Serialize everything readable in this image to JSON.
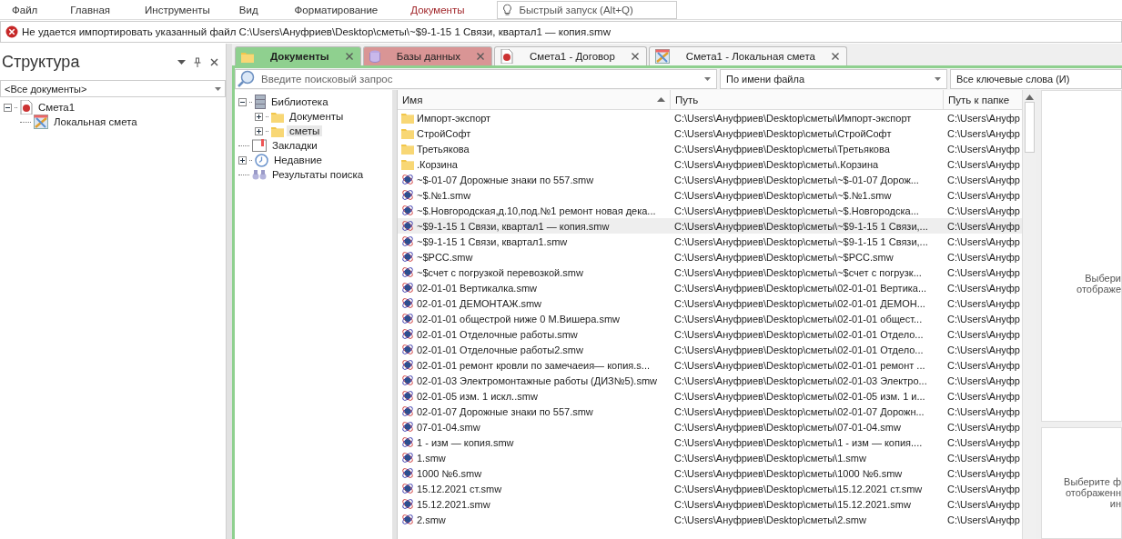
{
  "menu": [
    {
      "label": "Файл",
      "selected": false
    },
    {
      "label": "Главная",
      "selected": false
    },
    {
      "label": "Инструменты",
      "selected": false
    },
    {
      "label": "Вид",
      "selected": false
    },
    {
      "label": "Форматирование",
      "selected": false
    },
    {
      "label": "Документы",
      "selected": true
    }
  ],
  "quick_launch": {
    "placeholder": "Быстрый запуск (Alt+Q)"
  },
  "error_bar": {
    "message": "Не удается импортировать указанный файл C:\\Users\\Ануфриев\\Desktop\\сметы\\~$9-1-15 1 Связи, квартал1 — копия.smw"
  },
  "structure_panel": {
    "title": "Структура",
    "filter": "<Все документы>",
    "tree": [
      {
        "label": "Смета1",
        "kind": "estimate",
        "expanded": true,
        "children": [
          {
            "label": "Локальная смета",
            "kind": "local"
          }
        ]
      }
    ]
  },
  "tabs": [
    {
      "label": "Документы",
      "kind": "folder",
      "selected": true,
      "color": "#8fd08f"
    },
    {
      "label": "Базы данных",
      "kind": "database",
      "selected": false,
      "color": "#d99595"
    },
    {
      "label": "Смета1 - Договор",
      "kind": "estimate",
      "selected": false,
      "color": "#f7f7f7"
    },
    {
      "label": "Смета1 - Локальная смета",
      "kind": "local",
      "selected": false,
      "color": "#f7f7f7"
    }
  ],
  "search": {
    "placeholder": "Введите поисковый запрос",
    "mode": "По имени файла",
    "keywords": "Все ключевые слова (И)"
  },
  "library_tree": [
    {
      "label": "Библиотека",
      "kind": "library",
      "expanded": true,
      "selected": false,
      "children": [
        {
          "label": "Документы",
          "kind": "folder",
          "expanded": false,
          "selected": false
        },
        {
          "label": "сметы",
          "kind": "folder",
          "expanded": false,
          "selected": true
        }
      ]
    },
    {
      "label": "Закладки",
      "kind": "bookmarks",
      "selected": false
    },
    {
      "label": "Недавние",
      "kind": "recent",
      "expanded": false,
      "selected": false
    },
    {
      "label": "Результаты поиска",
      "kind": "search",
      "selected": false
    }
  ],
  "table": {
    "columns": [
      "Имя",
      "Путь",
      "Путь к папке"
    ],
    "rows": [
      {
        "kind": "folder",
        "selected": false,
        "cells": [
          "Импорт-экспорт",
          "C:\\Users\\Ануфриев\\Desktop\\сметы\\Импорт-экспорт",
          "C:\\Users\\Ануфр"
        ]
      },
      {
        "kind": "folder",
        "selected": false,
        "cells": [
          "СтройСофт",
          "C:\\Users\\Ануфриев\\Desktop\\сметы\\СтройСофт",
          "C:\\Users\\Ануфр"
        ]
      },
      {
        "kind": "folder",
        "selected": false,
        "cells": [
          "Третьякова",
          "C:\\Users\\Ануфриев\\Desktop\\сметы\\Третьякова",
          "C:\\Users\\Ануфр"
        ]
      },
      {
        "kind": "folder",
        "selected": false,
        "cells": [
          ".Корзина",
          "C:\\Users\\Ануфриев\\Desktop\\сметы\\.Корзина",
          "C:\\Users\\Ануфр"
        ]
      },
      {
        "kind": "file",
        "selected": false,
        "cells": [
          "~$-01-07 Дорожные знаки по 557.smw",
          "C:\\Users\\Ануфриев\\Desktop\\сметы\\~$-01-07 Дорож...",
          "C:\\Users\\Ануфр"
        ]
      },
      {
        "kind": "file",
        "selected": false,
        "cells": [
          "~$.№1.smw",
          "C:\\Users\\Ануфриев\\Desktop\\сметы\\~$.№1.smw",
          "C:\\Users\\Ануфр"
        ]
      },
      {
        "kind": "file",
        "selected": false,
        "cells": [
          "~$.Новгородская,д.10,под.№1 ремонт новая дека...",
          "C:\\Users\\Ануфриев\\Desktop\\сметы\\~$.Новгородска...",
          "C:\\Users\\Ануфр"
        ]
      },
      {
        "kind": "file",
        "selected": true,
        "cells": [
          "~$9-1-15 1 Связи, квартал1 — копия.smw",
          "C:\\Users\\Ануфриев\\Desktop\\сметы\\~$9-1-15 1 Связи,...",
          "C:\\Users\\Ануфр"
        ]
      },
      {
        "kind": "file",
        "selected": false,
        "cells": [
          "~$9-1-15 1 Связи, квартал1.smw",
          "C:\\Users\\Ануфриев\\Desktop\\сметы\\~$9-1-15 1 Связи,...",
          "C:\\Users\\Ануфр"
        ]
      },
      {
        "kind": "file",
        "selected": false,
        "cells": [
          "~$PCC.smw",
          "C:\\Users\\Ануфриев\\Desktop\\сметы\\~$PCC.smw",
          "C:\\Users\\Ануфр"
        ]
      },
      {
        "kind": "file",
        "selected": false,
        "cells": [
          "~$счет с погрузкой перевозкой.smw",
          "C:\\Users\\Ануфриев\\Desktop\\сметы\\~$счет с погрузк...",
          "C:\\Users\\Ануфр"
        ]
      },
      {
        "kind": "file",
        "selected": false,
        "cells": [
          "02-01-01 Вертикалка.smw",
          "C:\\Users\\Ануфриев\\Desktop\\сметы\\02-01-01 Вертика...",
          "C:\\Users\\Ануфр"
        ]
      },
      {
        "kind": "file",
        "selected": false,
        "cells": [
          "02-01-01 ДЕМОНТАЖ.smw",
          "C:\\Users\\Ануфриев\\Desktop\\сметы\\02-01-01 ДЕМОН...",
          "C:\\Users\\Ануфр"
        ]
      },
      {
        "kind": "file",
        "selected": false,
        "cells": [
          "02-01-01 общестрой ниже 0 М.Вишера.smw",
          "C:\\Users\\Ануфриев\\Desktop\\сметы\\02-01-01 общест...",
          "C:\\Users\\Ануфр"
        ]
      },
      {
        "kind": "file",
        "selected": false,
        "cells": [
          "02-01-01 Отделочные работы.smw",
          "C:\\Users\\Ануфриев\\Desktop\\сметы\\02-01-01 Отдело...",
          "C:\\Users\\Ануфр"
        ]
      },
      {
        "kind": "file",
        "selected": false,
        "cells": [
          "02-01-01 Отделочные работы2.smw",
          "C:\\Users\\Ануфриев\\Desktop\\сметы\\02-01-01 Отдело...",
          "C:\\Users\\Ануфр"
        ]
      },
      {
        "kind": "file",
        "selected": false,
        "cells": [
          "02-01-01 ремонт кровли по замечаеия— копия.s...",
          "C:\\Users\\Ануфриев\\Desktop\\сметы\\02-01-01 ремонт ...",
          "C:\\Users\\Ануфр"
        ]
      },
      {
        "kind": "file",
        "selected": false,
        "cells": [
          "02-01-03 Электромонтажные работы (ДИЗ№5).smw",
          "C:\\Users\\Ануфриев\\Desktop\\сметы\\02-01-03 Электро...",
          "C:\\Users\\Ануфр"
        ]
      },
      {
        "kind": "file",
        "selected": false,
        "cells": [
          "02-01-05 изм. 1 искл..smw",
          "C:\\Users\\Ануфриев\\Desktop\\сметы\\02-01-05 изм. 1 и...",
          "C:\\Users\\Ануфр"
        ]
      },
      {
        "kind": "file",
        "selected": false,
        "cells": [
          "02-01-07 Дорожные знаки по 557.smw",
          "C:\\Users\\Ануфриев\\Desktop\\сметы\\02-01-07 Дорожн...",
          "C:\\Users\\Ануфр"
        ]
      },
      {
        "kind": "file",
        "selected": false,
        "cells": [
          "07-01-04.smw",
          "C:\\Users\\Ануфриев\\Desktop\\сметы\\07-01-04.smw",
          "C:\\Users\\Ануфр"
        ]
      },
      {
        "kind": "file",
        "selected": false,
        "cells": [
          "1 - изм — копия.smw",
          "C:\\Users\\Ануфриев\\Desktop\\сметы\\1 - изм — копия....",
          "C:\\Users\\Ануфр"
        ]
      },
      {
        "kind": "file",
        "selected": false,
        "cells": [
          "1.smw",
          "C:\\Users\\Ануфриев\\Desktop\\сметы\\1.smw",
          "C:\\Users\\Ануфр"
        ]
      },
      {
        "kind": "file",
        "selected": false,
        "cells": [
          "1000 №6.smw",
          "C:\\Users\\Ануфриев\\Desktop\\сметы\\1000 №6.smw",
          "C:\\Users\\Ануфр"
        ]
      },
      {
        "kind": "file",
        "selected": false,
        "cells": [
          "15.12.2021 ст.smw",
          "C:\\Users\\Ануфриев\\Desktop\\сметы\\15.12.2021 ст.smw",
          "C:\\Users\\Ануфр"
        ]
      },
      {
        "kind": "file",
        "selected": false,
        "cells": [
          "15.12.2021.smw",
          "C:\\Users\\Ануфриев\\Desktop\\сметы\\15.12.2021.smw",
          "C:\\Users\\Ануфр"
        ]
      },
      {
        "kind": "file",
        "selected": false,
        "cells": [
          "2.smw",
          "C:\\Users\\Ануфриев\\Desktop\\сметы\\2.smw",
          "C:\\Users\\Ануфр"
        ]
      }
    ]
  },
  "preview_top": [
    "Выбери",
    "отображе"
  ],
  "preview_bottom": [
    "Выберите ф",
    "отображенн",
    "ин"
  ]
}
